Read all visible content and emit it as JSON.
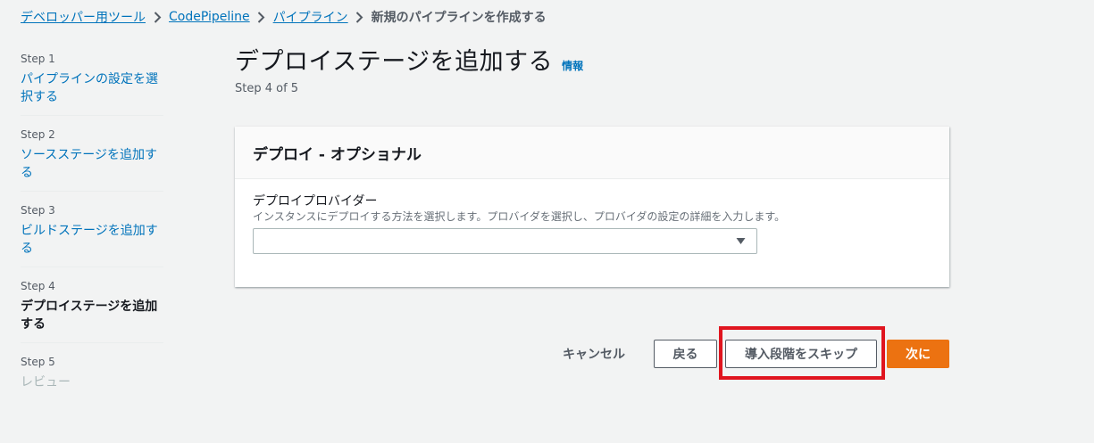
{
  "breadcrumb": {
    "items": [
      "デベロッパー用ツール",
      "CodePipeline",
      "パイプライン"
    ],
    "current": "新規のパイプラインを作成する"
  },
  "steps": [
    {
      "num": "Step 1",
      "label": "パイプラインの設定を選択する",
      "state": "link"
    },
    {
      "num": "Step 2",
      "label": "ソースステージを追加する",
      "state": "link"
    },
    {
      "num": "Step 3",
      "label": "ビルドステージを追加する",
      "state": "link"
    },
    {
      "num": "Step 4",
      "label": "デプロイステージを追加する",
      "state": "current"
    },
    {
      "num": "Step 5",
      "label": "レビュー",
      "state": "disabled"
    }
  ],
  "page": {
    "title": "デプロイステージを追加する",
    "info_link": "情報",
    "step_of": "Step 4 of 5"
  },
  "panel": {
    "header": "デプロイ - オプショナル",
    "field_label": "デプロイプロバイダー",
    "field_desc": "インスタンスにデプロイする方法を選択します。プロバイダを選択し、プロバイダの設定の詳細を入力します。",
    "select_value": ""
  },
  "actions": {
    "cancel": "キャンセル",
    "back": "戻る",
    "skip": "導入段階をスキップ",
    "next": "次に"
  },
  "colors": {
    "link": "#0073bb",
    "primary": "#ec7211",
    "highlight": "#e0151f",
    "background": "#f2f3f3"
  }
}
